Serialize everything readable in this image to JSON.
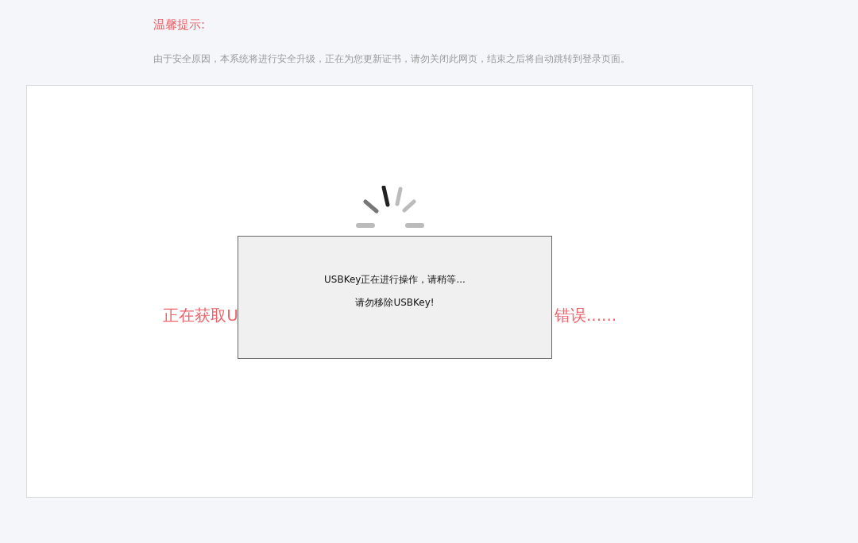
{
  "notice": {
    "title": "温馨提示:",
    "message": "由于安全原因，本系统将进行安全升级，正在为您更新证书，请勿关闭此网页，结束之后将自动跳转到登录页面。"
  },
  "status": {
    "text_left": "正在获取U",
    "text_right": "错误......"
  },
  "dialog": {
    "lines": [
      "USBKey正在进行操作，请稍等...",
      "请勿移除USBKey!"
    ]
  }
}
